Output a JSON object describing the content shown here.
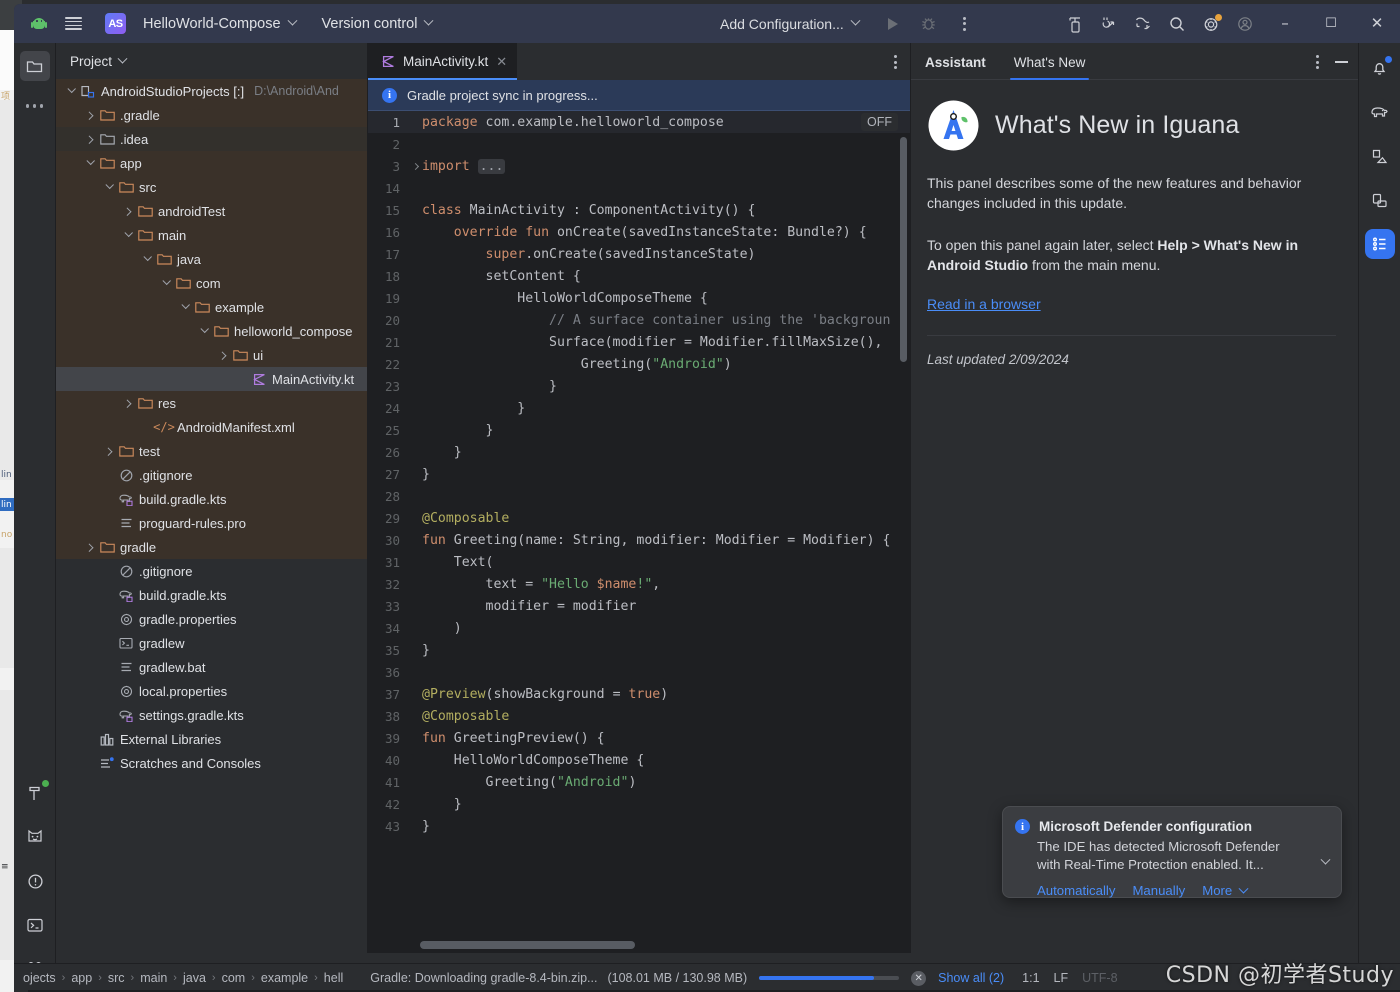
{
  "titlebar": {
    "app_icon": "android-robot-icon",
    "menu_icon": "hamburger-menu-icon",
    "product_badge": "AS",
    "project_name": "HelloWorld-Compose",
    "vcs_label": "Version control",
    "run_config": "Add Configuration...",
    "run_icon": "run-icon",
    "debug_icon": "debug-icon",
    "more_icon": "more-vertical-icon",
    "device_manager_icon": "device-manager-icon",
    "sdk_icon": "sdk-manager-icon",
    "layout_inspector_icon": "layout-inspector-icon",
    "search_icon": "search-icon",
    "settings_icon": "settings-gear-icon",
    "account_icon": "account-icon",
    "minimize": "–",
    "maximize": "☐",
    "close": "✕"
  },
  "left_strip": {
    "project_icon": "project-folder-icon",
    "more_icon": "more-horizontal-icon",
    "bottom_icons": [
      "build-hammer-icon",
      "logcat-cat-icon",
      "problems-icon",
      "terminal-icon",
      "version-control-branch-icon"
    ]
  },
  "right_strip": {
    "icons": [
      "notifications-bell-icon",
      "gradle-elephant-icon",
      "device-file-explorer-icon",
      "emulator-icon",
      "assistant-list-icon"
    ]
  },
  "project_panel": {
    "title": "Project",
    "dropdown_icon": "chevron-down-icon",
    "tree": [
      {
        "indent": 0,
        "arrow": "down",
        "icon": "project-root-icon",
        "label": "AndroidStudioProjects [:]",
        "suffix": "D:\\Android\\And",
        "style": "root"
      },
      {
        "indent": 1,
        "arrow": "right",
        "icon": "folder-orange",
        "label": ".gradle",
        "style": "module"
      },
      {
        "indent": 1,
        "arrow": "right",
        "icon": "folder-grey",
        "label": ".idea",
        "style": "module-alt"
      },
      {
        "indent": 1,
        "arrow": "down",
        "icon": "folder-orange",
        "label": "app",
        "style": "module"
      },
      {
        "indent": 2,
        "arrow": "down",
        "icon": "folder-orange",
        "label": "src",
        "style": "module"
      },
      {
        "indent": 3,
        "arrow": "right",
        "icon": "folder-orange",
        "label": "androidTest",
        "style": "module"
      },
      {
        "indent": 3,
        "arrow": "down",
        "icon": "folder-orange",
        "label": "main",
        "style": "module"
      },
      {
        "indent": 4,
        "arrow": "down",
        "icon": "folder-orange",
        "label": "java",
        "style": "module"
      },
      {
        "indent": 5,
        "arrow": "down",
        "icon": "folder-orange",
        "label": "com",
        "style": "module"
      },
      {
        "indent": 6,
        "arrow": "down",
        "icon": "folder-orange",
        "label": "example",
        "style": "module"
      },
      {
        "indent": 7,
        "arrow": "down",
        "icon": "folder-orange",
        "label": "helloworld_compose",
        "style": "module"
      },
      {
        "indent": 8,
        "arrow": "right",
        "icon": "folder-orange",
        "label": "ui",
        "style": "module"
      },
      {
        "indent": 9,
        "arrow": "none",
        "icon": "kotlin-file-icon",
        "label": "MainActivity.kt",
        "style": "selected"
      },
      {
        "indent": 3,
        "arrow": "right",
        "icon": "folder-orange",
        "label": "res",
        "style": "module"
      },
      {
        "indent": 4,
        "arrow": "none",
        "icon": "xml-file-icon",
        "label": "AndroidManifest.xml",
        "style": "module"
      },
      {
        "indent": 2,
        "arrow": "right",
        "icon": "folder-orange",
        "label": "test",
        "style": "module"
      },
      {
        "indent": 2,
        "arrow": "none",
        "icon": "gitignore-icon",
        "label": ".gitignore",
        "style": "module"
      },
      {
        "indent": 2,
        "arrow": "none",
        "icon": "gradle-file-icon",
        "label": "build.gradle.kts",
        "style": "module"
      },
      {
        "indent": 2,
        "arrow": "none",
        "icon": "text-file-icon",
        "label": "proguard-rules.pro",
        "style": "module"
      },
      {
        "indent": 1,
        "arrow": "right",
        "icon": "folder-orange",
        "label": "gradle",
        "style": "module"
      },
      {
        "indent": 2,
        "arrow": "none",
        "icon": "gitignore-icon",
        "label": ".gitignore",
        "style": "plain"
      },
      {
        "indent": 2,
        "arrow": "none",
        "icon": "gradle-file-icon",
        "label": "build.gradle.kts",
        "style": "plain"
      },
      {
        "indent": 2,
        "arrow": "none",
        "icon": "properties-icon",
        "label": "gradle.properties",
        "style": "plain"
      },
      {
        "indent": 2,
        "arrow": "none",
        "icon": "shell-file-icon",
        "label": "gradlew",
        "style": "plain"
      },
      {
        "indent": 2,
        "arrow": "none",
        "icon": "text-file-icon",
        "label": "gradlew.bat",
        "style": "plain"
      },
      {
        "indent": 2,
        "arrow": "none",
        "icon": "properties-icon",
        "label": "local.properties",
        "style": "plain"
      },
      {
        "indent": 2,
        "arrow": "none",
        "icon": "gradle-file-icon",
        "label": "settings.gradle.kts",
        "style": "plain"
      },
      {
        "indent": 1,
        "arrow": "none",
        "icon": "library-icon",
        "label": "External Libraries",
        "style": "plain"
      },
      {
        "indent": 1,
        "arrow": "none",
        "icon": "scratches-icon",
        "label": "Scratches and Consoles",
        "style": "plain"
      }
    ]
  },
  "editor": {
    "tab_label": "MainActivity.kt",
    "tab_icon": "kotlin-file-icon",
    "tab_close_icon": "close-icon",
    "tab_options_icon": "more-vertical-icon",
    "banner_text": "Gradle project sync in progress...",
    "banner_icon": "info-icon",
    "inspection_badge": "OFF",
    "lines": [
      {
        "n": "1",
        "cur": true,
        "fold": false,
        "tokens": [
          [
            "kw",
            "package"
          ],
          [
            "plain",
            " com.example.helloworld_compose"
          ]
        ]
      },
      {
        "n": "2",
        "cur": false,
        "fold": false,
        "tokens": []
      },
      {
        "n": "3",
        "cur": false,
        "fold": true,
        "tokens": [
          [
            "kw",
            "import"
          ],
          [
            "plain",
            " "
          ],
          [
            "fold",
            "..."
          ]
        ]
      },
      {
        "n": "14",
        "cur": false,
        "fold": false,
        "tokens": []
      },
      {
        "n": "15",
        "cur": false,
        "fold": false,
        "tokens": [
          [
            "kw",
            "class"
          ],
          [
            "plain",
            " MainActivity : ComponentActivity() {"
          ]
        ]
      },
      {
        "n": "16",
        "cur": false,
        "fold": false,
        "tokens": [
          [
            "plain",
            "    "
          ],
          [
            "kw",
            "override fun"
          ],
          [
            "plain",
            " onCreate(savedInstanceState: Bundle?) {"
          ]
        ]
      },
      {
        "n": "17",
        "cur": false,
        "fold": false,
        "tokens": [
          [
            "plain",
            "        "
          ],
          [
            "kw",
            "super"
          ],
          [
            "plain",
            ".onCreate(savedInstanceState)"
          ]
        ]
      },
      {
        "n": "18",
        "cur": false,
        "fold": false,
        "tokens": [
          [
            "plain",
            "        setContent {"
          ]
        ]
      },
      {
        "n": "19",
        "cur": false,
        "fold": false,
        "tokens": [
          [
            "plain",
            "            HelloWorldComposeTheme {"
          ]
        ]
      },
      {
        "n": "20",
        "cur": false,
        "fold": false,
        "tokens": [
          [
            "cmt",
            "                // A surface container using the 'backgroun"
          ]
        ]
      },
      {
        "n": "21",
        "cur": false,
        "fold": false,
        "tokens": [
          [
            "plain",
            "                Surface(modifier = Modifier.fillMaxSize(),"
          ]
        ]
      },
      {
        "n": "22",
        "cur": false,
        "fold": false,
        "tokens": [
          [
            "plain",
            "                    Greeting("
          ],
          [
            "str",
            "\"Android\""
          ],
          [
            "plain",
            ")"
          ]
        ]
      },
      {
        "n": "23",
        "cur": false,
        "fold": false,
        "tokens": [
          [
            "plain",
            "                }"
          ]
        ]
      },
      {
        "n": "24",
        "cur": false,
        "fold": false,
        "tokens": [
          [
            "plain",
            "            }"
          ]
        ]
      },
      {
        "n": "25",
        "cur": false,
        "fold": false,
        "tokens": [
          [
            "plain",
            "        }"
          ]
        ]
      },
      {
        "n": "26",
        "cur": false,
        "fold": false,
        "tokens": [
          [
            "plain",
            "    }"
          ]
        ]
      },
      {
        "n": "27",
        "cur": false,
        "fold": false,
        "tokens": [
          [
            "plain",
            "}"
          ]
        ]
      },
      {
        "n": "28",
        "cur": false,
        "fold": false,
        "tokens": []
      },
      {
        "n": "29",
        "cur": false,
        "fold": false,
        "tokens": [
          [
            "ann",
            "@Composable"
          ]
        ]
      },
      {
        "n": "30",
        "cur": false,
        "fold": false,
        "tokens": [
          [
            "kw",
            "fun"
          ],
          [
            "plain",
            " Greeting(name: String, modifier: Modifier = Modifier) {"
          ]
        ]
      },
      {
        "n": "31",
        "cur": false,
        "fold": false,
        "tokens": [
          [
            "plain",
            "    Text("
          ]
        ]
      },
      {
        "n": "32",
        "cur": false,
        "fold": false,
        "tokens": [
          [
            "plain",
            "        text = "
          ],
          [
            "str",
            "\"Hello "
          ],
          [
            "tmpl",
            "$name"
          ],
          [
            "str",
            "!\""
          ],
          [
            "plain",
            ","
          ]
        ]
      },
      {
        "n": "33",
        "cur": false,
        "fold": false,
        "tokens": [
          [
            "plain",
            "        modifier = modifier"
          ]
        ]
      },
      {
        "n": "34",
        "cur": false,
        "fold": false,
        "tokens": [
          [
            "plain",
            "    )"
          ]
        ]
      },
      {
        "n": "35",
        "cur": false,
        "fold": false,
        "tokens": [
          [
            "plain",
            "}"
          ]
        ]
      },
      {
        "n": "36",
        "cur": false,
        "fold": false,
        "tokens": []
      },
      {
        "n": "37",
        "cur": false,
        "fold": false,
        "tokens": [
          [
            "ann",
            "@Preview"
          ],
          [
            "plain",
            "(showBackground = "
          ],
          [
            "kw",
            "true"
          ],
          [
            "plain",
            ")"
          ]
        ]
      },
      {
        "n": "38",
        "cur": false,
        "fold": false,
        "tokens": [
          [
            "ann",
            "@Composable"
          ]
        ]
      },
      {
        "n": "39",
        "cur": false,
        "fold": false,
        "tokens": [
          [
            "kw",
            "fun"
          ],
          [
            "plain",
            " GreetingPreview() {"
          ]
        ]
      },
      {
        "n": "40",
        "cur": false,
        "fold": false,
        "tokens": [
          [
            "plain",
            "    HelloWorldComposeTheme {"
          ]
        ]
      },
      {
        "n": "41",
        "cur": false,
        "fold": false,
        "tokens": [
          [
            "plain",
            "        Greeting("
          ],
          [
            "str",
            "\"Android\""
          ],
          [
            "plain",
            ")"
          ]
        ]
      },
      {
        "n": "42",
        "cur": false,
        "fold": false,
        "tokens": [
          [
            "plain",
            "    }"
          ]
        ]
      },
      {
        "n": "43",
        "cur": false,
        "fold": false,
        "tokens": [
          [
            "plain",
            "}"
          ]
        ]
      }
    ]
  },
  "assistant": {
    "tab_assistant": "Assistant",
    "tab_whats_new": "What's New",
    "options_icon": "more-vertical-icon",
    "minimize_icon": "minimize-icon",
    "logo_icon": "android-studio-logo-icon",
    "heading": "What's New in Iguana",
    "paragraph1": "This panel describes some of the new features and behavior changes included in this update.",
    "paragraph2_pre": "To open this panel again later, select ",
    "paragraph2_bold": "Help > What's New in Android Studio",
    "paragraph2_post": " from the main menu.",
    "link": "Read in a browser",
    "last_updated": "Last updated 2/09/2024"
  },
  "toast": {
    "icon": "info-icon",
    "title": "Microsoft Defender configuration",
    "body": "The IDE has detected Microsoft Defender with Real-Time Protection enabled. It...",
    "actions": [
      "Automatically",
      "Manually"
    ],
    "more_label": "More",
    "more_icon": "chevron-down-icon",
    "expand_icon": "chevron-down-icon"
  },
  "statusbar": {
    "breadcrumbs": [
      "ojects",
      "app",
      "src",
      "main",
      "java",
      "com",
      "example",
      "hell"
    ],
    "separator": "›",
    "gradle_task": "Gradle: Downloading gradle-8.4-bin.zip...",
    "download_size": "(108.01 MB / 130.98 MB)",
    "progress_percent": 82,
    "cancel_icon": "cancel-icon",
    "show_all": "Show all (2)",
    "caret_position": "1:1",
    "line_separator": "LF",
    "encoding": "UTF-8"
  },
  "watermark": {
    "text": "CSDN @初学者Study"
  },
  "colors": {
    "accent_blue": "#3574f0",
    "link_blue": "#4a8df8",
    "title_bar": "#33394d",
    "panel_bg": "#2b2d30",
    "editor_bg": "#1e1f22",
    "module_tint": "#3a3129",
    "selection": "#43454a",
    "keyword": "#cf8e6d",
    "string": "#6aab73",
    "comment": "#7a7e85",
    "annotation": "#b3ae60"
  }
}
